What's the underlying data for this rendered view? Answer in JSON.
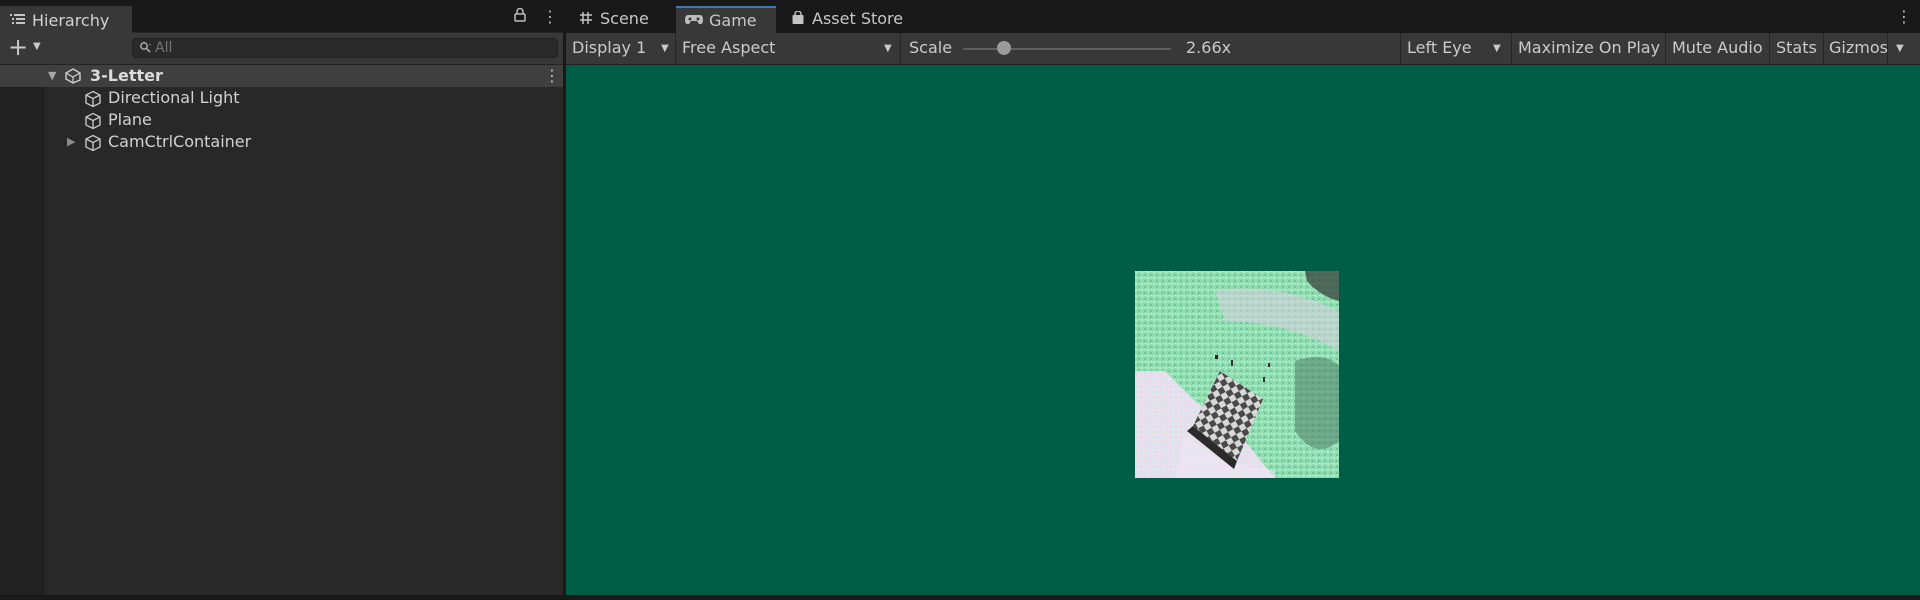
{
  "hierarchy": {
    "tab_label": "Hierarchy",
    "tab_icon": "list-icon",
    "search_placeholder": "All",
    "scene": {
      "name": "3-Letter",
      "icon": "unity-scene-icon"
    },
    "items": [
      {
        "label": "Directional Light",
        "icon": "gameobject-cube-icon",
        "expandable": false
      },
      {
        "label": "Plane",
        "icon": "gameobject-cube-icon",
        "expandable": false
      },
      {
        "label": "CamCtrlContainer",
        "icon": "gameobject-cube-icon",
        "expandable": true
      }
    ]
  },
  "tabs": [
    {
      "label": "Scene",
      "icon": "grid-hash-icon",
      "active": false
    },
    {
      "label": "Game",
      "icon": "gamepad-icon",
      "active": true
    },
    {
      "label": "Asset Store",
      "icon": "shopping-bag-icon",
      "active": false
    }
  ],
  "game_toolbar": {
    "display": "Display 1",
    "aspect": "Free Aspect",
    "scale_label": "Scale",
    "scale_value": "2.66x",
    "eye": "Left Eye",
    "maximize_on_play": "Maximize On Play",
    "mute_audio": "Mute Audio",
    "stats": "Stats",
    "gizmos": "Gizmos"
  },
  "colors": {
    "viewport_background": "#005e47",
    "active_tab_accent": "#3a79bb",
    "panel_background": "#282828",
    "toolbar_background": "#383838"
  }
}
